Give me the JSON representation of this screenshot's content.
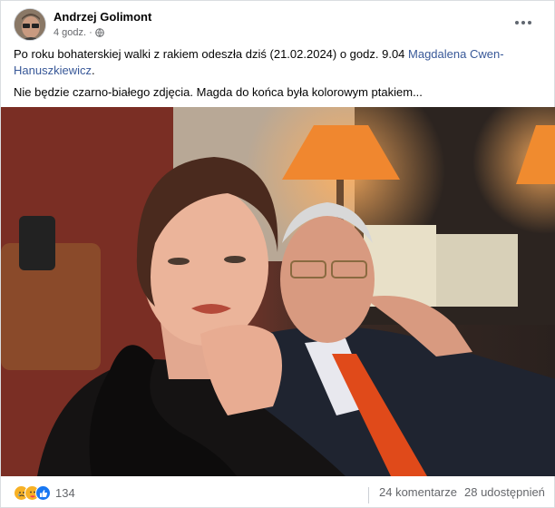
{
  "post": {
    "author": "Andrzej Golimont",
    "time": "4 godz.",
    "privacy_icon": "globe-icon",
    "more_icon": "more-options-icon",
    "text_line1_main": "Po roku bohaterskiej walki z rakiem odeszła dziś (21.02.2024) o godz. 9.04 ",
    "text_line1_mention": "Magdalena Cwen-Hanuszkiewicz",
    "text_line1_end": ".",
    "text_line2": "Nie będzie czarno-białego zdjęcia. Magda do końca była kolorowym ptakiem..."
  },
  "footer": {
    "reaction_icons": [
      "sad-reaction-icon",
      "care-reaction-icon",
      "like-reaction-icon"
    ],
    "reaction_count": "134",
    "comments": "24 komentarze",
    "shares": "28 udostępnień"
  },
  "colors": {
    "link": "#385898",
    "secondary_text": "#65676b",
    "like_blue": "#1877f2"
  }
}
